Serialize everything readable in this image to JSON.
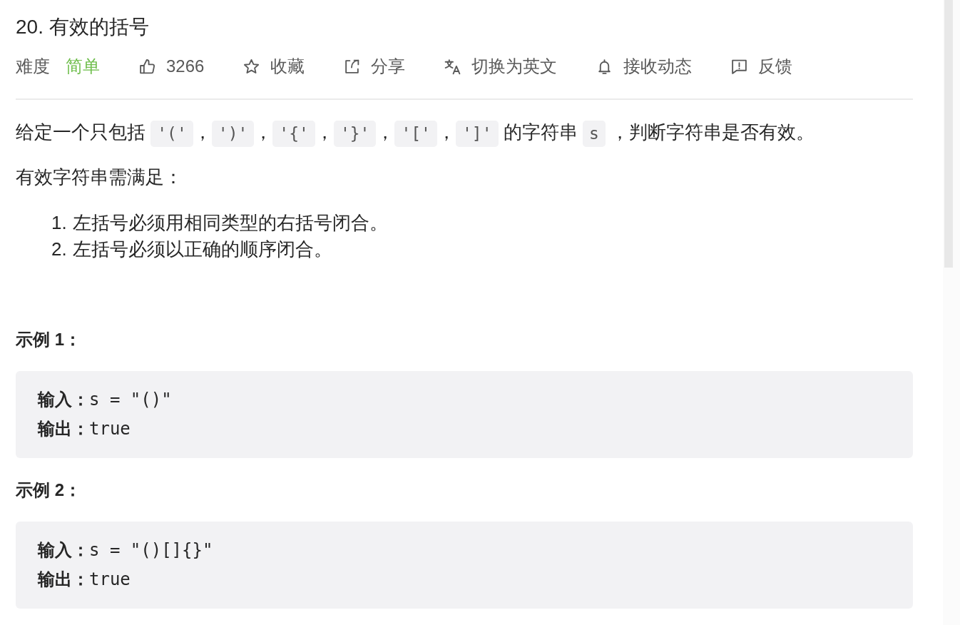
{
  "problem": {
    "title": "20. 有效的括号",
    "difficulty": {
      "label": "难度",
      "value": "简单"
    },
    "actions": [
      {
        "kind": "like",
        "label": "3266"
      },
      {
        "kind": "favorite",
        "label": "收藏"
      },
      {
        "kind": "share",
        "label": "分享"
      },
      {
        "kind": "translate",
        "label": "切换为英文"
      },
      {
        "kind": "subscribe",
        "label": "接收动态"
      },
      {
        "kind": "feedback",
        "label": "反馈"
      }
    ]
  },
  "description": {
    "intro": [
      {
        "kind": "text",
        "text": "给定一个只包括 "
      },
      {
        "kind": "code",
        "text": "'('"
      },
      {
        "kind": "text",
        "text": "，"
      },
      {
        "kind": "code",
        "text": "')'"
      },
      {
        "kind": "text",
        "text": "，"
      },
      {
        "kind": "code",
        "text": "'{'"
      },
      {
        "kind": "text",
        "text": "，"
      },
      {
        "kind": "code",
        "text": "'}'"
      },
      {
        "kind": "text",
        "text": "，"
      },
      {
        "kind": "code",
        "text": "'['"
      },
      {
        "kind": "text",
        "text": "，"
      },
      {
        "kind": "code",
        "text": "']'"
      },
      {
        "kind": "text",
        "text": " 的字符串 "
      },
      {
        "kind": "code",
        "text": "s"
      },
      {
        "kind": "text",
        "text": " ，判断字符串是否有效。"
      }
    ],
    "requirement": "有效字符串需满足：",
    "rules": [
      {
        "number": "1.",
        "text": "左括号必须用相同类型的右括号闭合。"
      },
      {
        "number": "2.",
        "text": "左括号必须以正确的顺序闭合。"
      }
    ]
  },
  "examples": [
    {
      "heading": "示例 1：",
      "lines": [
        "**输入：**s = \"()\"",
        "**输出：**true"
      ]
    },
    {
      "heading": "示例 2：",
      "lines": [
        "**输入：**s = \"()[]{}\"",
        "**输出：**true"
      ]
    }
  ]
}
